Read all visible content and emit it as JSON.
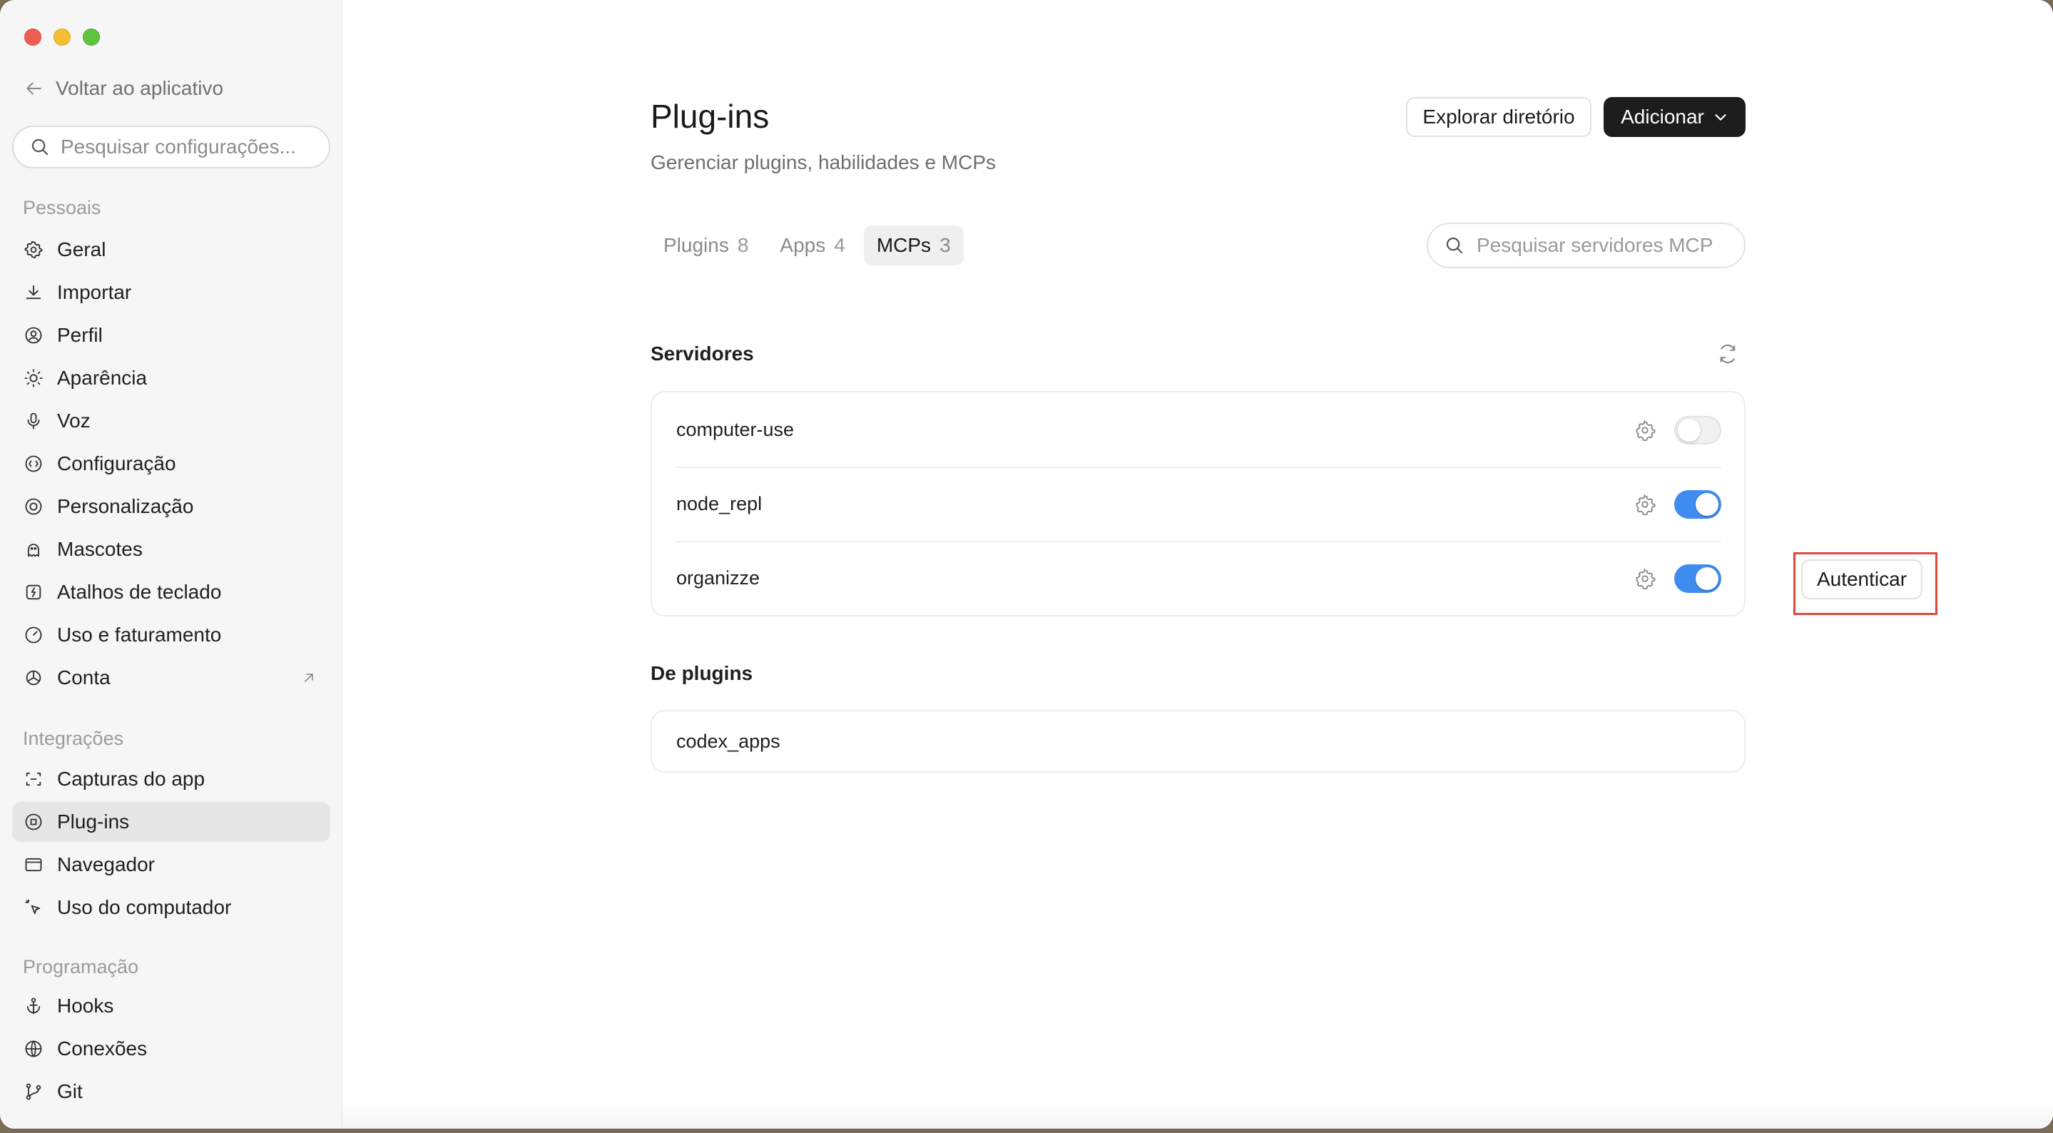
{
  "sidebar": {
    "back_label": "Voltar ao aplicativo",
    "search_placeholder": "Pesquisar configurações...",
    "sections": [
      {
        "label": "Pessoais",
        "items": [
          {
            "label": "Geral",
            "icon": "gear-icon"
          },
          {
            "label": "Importar",
            "icon": "download-icon"
          },
          {
            "label": "Perfil",
            "icon": "user-circle-icon"
          },
          {
            "label": "Aparência",
            "icon": "sun-icon"
          },
          {
            "label": "Voz",
            "icon": "microphone-icon"
          },
          {
            "label": "Configuração",
            "icon": "settings-badge-icon"
          },
          {
            "label": "Personalização",
            "icon": "palette-icon"
          },
          {
            "label": "Mascotes",
            "icon": "pet-icon"
          },
          {
            "label": "Atalhos de teclado",
            "icon": "keyboard-shortcut-icon"
          },
          {
            "label": "Uso e faturamento",
            "icon": "gauge-icon"
          },
          {
            "label": "Conta",
            "icon": "openai-logo-icon",
            "external": true
          }
        ]
      },
      {
        "label": "Integrações",
        "items": [
          {
            "label": "Capturas do app",
            "icon": "screen-capture-icon"
          },
          {
            "label": "Plug-ins",
            "icon": "plugin-icon",
            "active": true
          },
          {
            "label": "Navegador",
            "icon": "browser-window-icon"
          },
          {
            "label": "Uso do computador",
            "icon": "cursor-click-icon"
          }
        ]
      },
      {
        "label": "Programação",
        "items": [
          {
            "label": "Hooks",
            "icon": "anchor-icon"
          },
          {
            "label": "Conexões",
            "icon": "globe-icon"
          },
          {
            "label": "Git",
            "icon": "git-branch-icon"
          }
        ]
      }
    ]
  },
  "main": {
    "title": "Plug-ins",
    "subtitle": "Gerenciar plugins, habilidades e MCPs",
    "explore_label": "Explorar diretório",
    "add_label": "Adicionar",
    "tabs": [
      {
        "label": "Plugins",
        "count": "8",
        "active": false
      },
      {
        "label": "Apps",
        "count": "4",
        "active": false
      },
      {
        "label": "MCPs",
        "count": "3",
        "active": true
      }
    ],
    "search_placeholder": "Pesquisar servidores MCP",
    "servers_heading": "Servidores",
    "servers": [
      {
        "name": "computer-use",
        "enabled": false
      },
      {
        "name": "node_repl",
        "enabled": true
      },
      {
        "name": "organizze",
        "enabled": true,
        "action_label": "Autenticar"
      }
    ],
    "plugins_heading": "De plugins",
    "plugin_servers": [
      {
        "name": "codex_apps"
      }
    ]
  },
  "colors": {
    "accent": "#3f8cf0",
    "primary_button": "#1c1c1c",
    "highlight_box": "#e04a3a"
  }
}
